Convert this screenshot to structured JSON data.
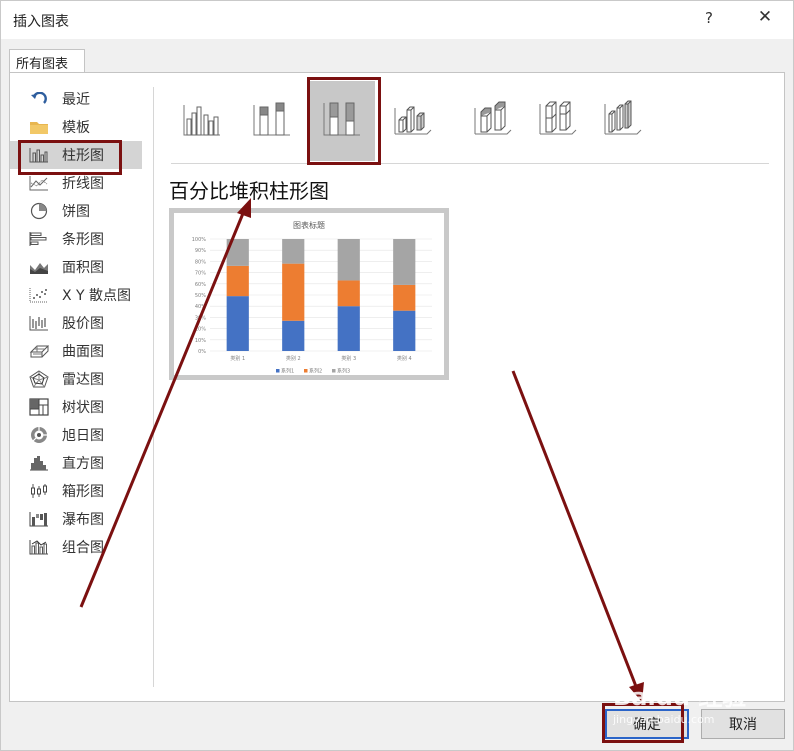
{
  "window": {
    "title": "插入图表",
    "help": "?",
    "close": "✕"
  },
  "tab": {
    "label": "所有图表"
  },
  "sidebar": {
    "items": [
      {
        "label": "最近",
        "icon": "recent-icon"
      },
      {
        "label": "模板",
        "icon": "folder-icon"
      },
      {
        "label": "柱形图",
        "icon": "column-chart-icon",
        "selected": true
      },
      {
        "label": "折线图",
        "icon": "line-chart-icon"
      },
      {
        "label": "饼图",
        "icon": "pie-chart-icon"
      },
      {
        "label": "条形图",
        "icon": "bar-chart-icon"
      },
      {
        "label": "面积图",
        "icon": "area-chart-icon"
      },
      {
        "label": "X Y 散点图",
        "icon": "scatter-chart-icon"
      },
      {
        "label": "股价图",
        "icon": "stock-chart-icon"
      },
      {
        "label": "曲面图",
        "icon": "surface-chart-icon"
      },
      {
        "label": "雷达图",
        "icon": "radar-chart-icon"
      },
      {
        "label": "树状图",
        "icon": "treemap-chart-icon"
      },
      {
        "label": "旭日图",
        "icon": "sunburst-chart-icon"
      },
      {
        "label": "直方图",
        "icon": "histogram-chart-icon"
      },
      {
        "label": "箱形图",
        "icon": "box-whisker-chart-icon"
      },
      {
        "label": "瀑布图",
        "icon": "waterfall-chart-icon"
      },
      {
        "label": "组合图",
        "icon": "combo-chart-icon"
      }
    ]
  },
  "chart_types": {
    "items": [
      {
        "icon": "clustered-column-icon"
      },
      {
        "icon": "stacked-column-icon"
      },
      {
        "icon": "percent-stacked-column-icon",
        "selected": true
      },
      {
        "icon": "3d-clustered-column-icon"
      },
      {
        "icon": "3d-stacked-column-icon"
      },
      {
        "icon": "3d-percent-stacked-column-icon"
      },
      {
        "icon": "3d-column-icon"
      }
    ],
    "selected_name": "百分比堆积柱形图"
  },
  "preview": {
    "chart_data": {
      "type": "bar",
      "stacked": "percent",
      "title": "图表标题",
      "categories": [
        "类别 1",
        "类别 2",
        "类别 3",
        "类别 4"
      ],
      "series": [
        {
          "name": "系列1",
          "color": "#4472c4",
          "values": [
            49,
            27,
            40,
            36
          ]
        },
        {
          "name": "系列2",
          "color": "#ed7d31",
          "values": [
            27,
            51,
            23,
            23
          ]
        },
        {
          "name": "系列3",
          "color": "#a5a5a5",
          "values": [
            24,
            22,
            37,
            41
          ]
        }
      ],
      "y_ticks": [
        "0%",
        "10%",
        "20%",
        "30%",
        "40%",
        "50%",
        "60%",
        "70%",
        "80%",
        "90%",
        "100%"
      ],
      "ylim": [
        0,
        100
      ],
      "grid": true,
      "legend": "bottom"
    }
  },
  "buttons": {
    "ok": "确定",
    "cancel": "取消"
  },
  "colors": {
    "annotation": "#7b1010",
    "accent": "#2a64c8"
  },
  "watermark": {
    "brand": "Baidu 经验",
    "url": "jingyan.baidu.com"
  }
}
